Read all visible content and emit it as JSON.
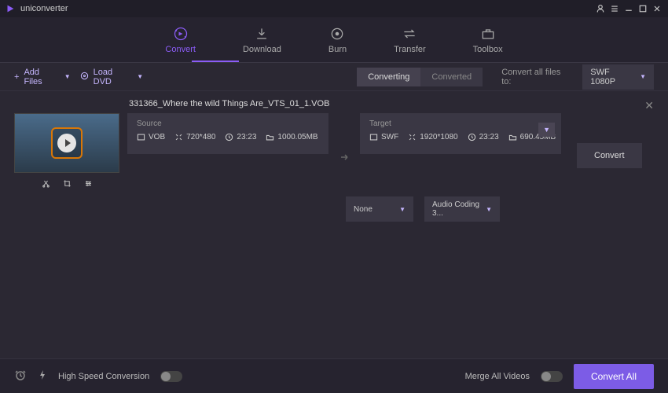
{
  "app_name": "uniconverter",
  "nav": {
    "tabs": [
      "Convert",
      "Download",
      "Burn",
      "Transfer",
      "Toolbox"
    ],
    "active": 0
  },
  "toolbar": {
    "add_files": "Add Files",
    "load_dvd": "Load DVD",
    "converting": "Converting",
    "converted": "Converted",
    "convert_all_label": "Convert all files to:",
    "output_format": "SWF 1080P"
  },
  "item": {
    "filename": "331366_Where the wild Things Are_VTS_01_1.VOB",
    "source": {
      "title": "Source",
      "format": "VOB",
      "resolution": "720*480",
      "duration": "23:23",
      "size": "1000.05MB"
    },
    "target": {
      "title": "Target",
      "format": "SWF",
      "resolution": "1920*1080",
      "duration": "23:23",
      "size": "690.45MB"
    },
    "convert_btn": "Convert",
    "subtitle": "None",
    "audio": "Audio Coding 3..."
  },
  "footer": {
    "hsc": "High Speed Conversion",
    "merge": "Merge All Videos",
    "convert_all": "Convert All"
  }
}
